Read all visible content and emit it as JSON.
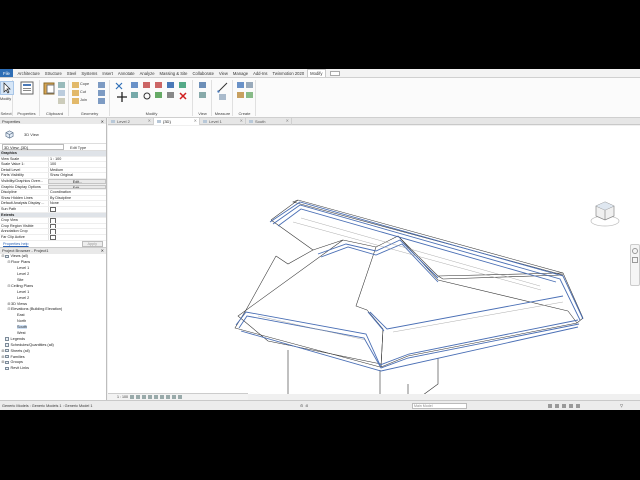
{
  "ribbon": {
    "file_tab": "File",
    "tabs": [
      "Architecture",
      "Structure",
      "Steel",
      "Systems",
      "Insert",
      "Annotate",
      "Analyze",
      "Massing & Site",
      "Collaborate",
      "View",
      "Manage",
      "Add-Ins",
      "Twinmotion 2020",
      "Modify"
    ],
    "active_tab": "Modify",
    "modify_label": "Modify",
    "select_label": "Select",
    "properties_label": "Properties",
    "clipboard_label": "Clipboard",
    "geometry_label": "Geometry",
    "modify_group_label": "Modify",
    "view_label": "View",
    "measure_label": "Measure",
    "create_label": "Create",
    "cope_label": "Cope",
    "cut_label": "Cut",
    "join_label": "Join"
  },
  "view_tabs": [
    {
      "label": "Level 2",
      "active": false
    },
    {
      "label": "{3D}",
      "active": true
    },
    {
      "label": "Level 1",
      "active": false
    },
    {
      "label": "South",
      "active": false
    }
  ],
  "properties": {
    "panel_title": "Properties",
    "type_name": "3D View",
    "selector_value": "3D View: {3D}",
    "edit_type": "Edit Type",
    "rows": [
      {
        "k": "Graphics",
        "v": "",
        "cat": true
      },
      {
        "k": "View Scale",
        "v": "1 : 100"
      },
      {
        "k": "Scale Value  1:",
        "v": "100"
      },
      {
        "k": "Detail Level",
        "v": "Medium"
      },
      {
        "k": "Parts Visibility",
        "v": "Show Original"
      },
      {
        "k": "Visibility/Graphics Overr...",
        "v": "Edit...",
        "btn": true
      },
      {
        "k": "Graphic Display Options",
        "v": "Edit...",
        "btn": true
      },
      {
        "k": "Discipline",
        "v": "Coordination"
      },
      {
        "k": "Show Hidden Lines",
        "v": "By Discipline"
      },
      {
        "k": "Default Analysis Display ...",
        "v": "None"
      },
      {
        "k": "Sun Path",
        "v": "",
        "cb": true
      },
      {
        "k": "Extents",
        "v": "",
        "cat": true
      },
      {
        "k": "Crop View",
        "v": "",
        "cb": true
      },
      {
        "k": "Crop Region Visible",
        "v": "",
        "cb": true
      },
      {
        "k": "Annotation Crop",
        "v": "",
        "cb": true
      },
      {
        "k": "Far Clip Active",
        "v": "",
        "cb": true
      }
    ],
    "help_link": "Properties help",
    "apply_label": "Apply"
  },
  "browser": {
    "title": "Project Browser - Project1",
    "nodes": [
      {
        "label": "Views (all)",
        "toggle": "⊟",
        "indent": 0,
        "icon": true
      },
      {
        "label": "Floor Plans",
        "toggle": "⊟",
        "indent": 1
      },
      {
        "label": "Level 1",
        "indent": 2
      },
      {
        "label": "Level 2",
        "indent": 2
      },
      {
        "label": "Site",
        "indent": 2
      },
      {
        "label": "Ceiling Plans",
        "toggle": "⊟",
        "indent": 1
      },
      {
        "label": "Level 1",
        "indent": 2
      },
      {
        "label": "Level 2",
        "indent": 2
      },
      {
        "label": "3D Views",
        "toggle": "⊞",
        "indent": 1
      },
      {
        "label": "Elevations (Building Elevation)",
        "toggle": "⊟",
        "indent": 1
      },
      {
        "label": "East",
        "indent": 2
      },
      {
        "label": "North",
        "indent": 2
      },
      {
        "label": "South",
        "indent": 2,
        "selected": true
      },
      {
        "label": "West",
        "indent": 2
      },
      {
        "label": "Legends",
        "indent": 0,
        "icon": true
      },
      {
        "label": "Schedules/Quantities (all)",
        "indent": 0,
        "icon": true
      },
      {
        "label": "Sheets (all)",
        "toggle": "⊞",
        "indent": 0,
        "icon": true
      },
      {
        "label": "Families",
        "toggle": "⊞",
        "indent": 0,
        "icon": true
      },
      {
        "label": "Groups",
        "toggle": "⊞",
        "indent": 0,
        "icon": true
      },
      {
        "label": "Revit Links",
        "indent": 0,
        "icon": true
      }
    ]
  },
  "view_control": {
    "scale": "1 : 100"
  },
  "status": {
    "text": "Generic Models : Generic Models 1 : Generic Model 1",
    "model_dropdown": "Main Model",
    "zero": ":0"
  }
}
